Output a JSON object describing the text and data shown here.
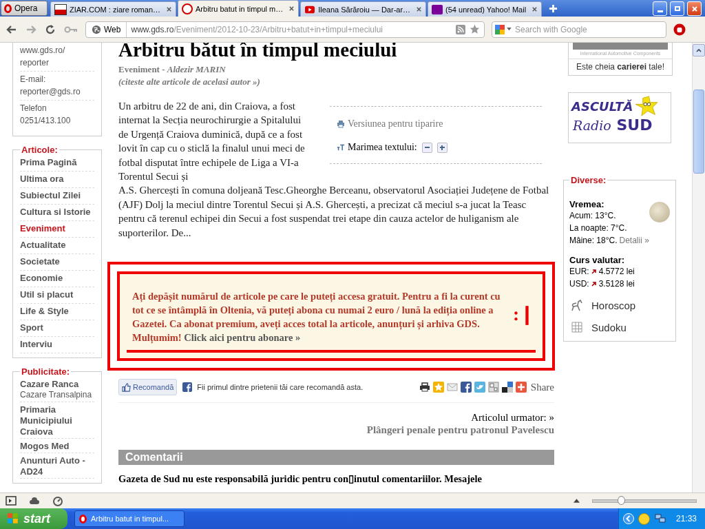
{
  "browser": {
    "menu_button": "Opera",
    "tabs": [
      {
        "label": "ZIAR.COM : ziare roman…",
        "selected": false,
        "kind": "ziar"
      },
      {
        "label": "Arbitru batut in timpul m…",
        "selected": true,
        "kind": "gds"
      },
      {
        "label": "Ileana Sărăroiu — Dar-ar…",
        "selected": false,
        "kind": "video"
      },
      {
        "label": "(54 unread) Yahoo! Mail",
        "selected": false,
        "kind": "yahoo"
      }
    ],
    "address": {
      "badge": "Web",
      "host": "www.gds.ro",
      "path": "/Eveniment/2012-10-23/Arbitru+batut+in+timpul+meciului"
    },
    "search": {
      "placeholder": "Search with Google"
    }
  },
  "sidebar": {
    "contact": [
      "www.gds.ro/ reporter",
      "E-mail: reporter@gds.ro",
      "Telefon 0251/413.100"
    ],
    "articles": {
      "title": "Articole:",
      "items": [
        {
          "label": "Prima Pagină",
          "selected": false
        },
        {
          "label": "Ultima ora",
          "selected": false
        },
        {
          "label": "Subiectul Zilei",
          "selected": false
        },
        {
          "label": "Cultura si Istorie",
          "selected": false
        },
        {
          "label": "Eveniment",
          "selected": true
        },
        {
          "label": "Actualitate",
          "selected": false
        },
        {
          "label": "Societate",
          "selected": false
        },
        {
          "label": "Economie",
          "selected": false
        },
        {
          "label": "Util si placut",
          "selected": false
        },
        {
          "label": "Life & Style",
          "selected": false
        },
        {
          "label": "Sport",
          "selected": false
        },
        {
          "label": "Interviu",
          "selected": false
        }
      ]
    },
    "ads": {
      "title": "Publicitate:",
      "items": [
        {
          "label": "Cazare Ranca",
          "sub": "Cazare Transalpina"
        },
        {
          "label": "Primaria Municipiului Craiova"
        },
        {
          "label": "Mogos Med"
        },
        {
          "label": "Anunturi Auto - AD24"
        }
      ]
    }
  },
  "article": {
    "title": "Arbitru bătut în timpul meciului",
    "byline": "Eveniment - *Aldezir MARIN*",
    "author_link": "(citeste alte articole de acelasi autor »)",
    "print_link": "Versiunea pentru tiparire",
    "text_size": "Marimea textului:",
    "body_lead": "Un arbitru de 22 de ani, din Craiova, a fost internat la Secția neurochirurgie a Spitalului de Urgență Craiova duminică, după ce a fost lovit în cap cu o sticlă la finalul unui meci de fotbal disputat între echipele de Liga a VI-a Torentul Secui și",
    "body_rest": "A.S. Ghercești în comuna doljeană Tesc.Gheorghe Berceanu, observatorul Asociației Județene de Fotbal (AJF) Dolj la meciul dintre Torentul Secui și A.S. Ghercești, a precizat că meciul s-a jucat la Teasc pentru că terenul echipei din Secui a fost suspendat trei etape din cauza actelor de huliganism ale suporterilor. De...",
    "notice": {
      "text": "Ați depășit numărul de articole pe care le puteți accesa gratuit. Pentru a fi la curent cu tot ce se întâmplă în Oltenia, vă puteți abona cu numai 2 euro / lună la ediția online a Gazetei. Ca abonat premium, aveți acces total la articole, anunțuri și arhiva GDS. Mulțumim!",
      "link": "Click aici pentru abonare »"
    },
    "recommend": "Recomandă",
    "recommend_text": "Fii primul dintre prietenii tăi care recomandă asta.",
    "share": "Share",
    "next_label": "Articolul urmator: »",
    "next_title": "Plângeri penale pentru patronul Pavelescu",
    "comments_heading": "Comentarii",
    "disclaimer": "Gazeta de Sud nu este responsabilă juridic pentru con▯inutul comentariilor. Mesajele"
  },
  "right": {
    "ad_caption": "International Automotive Components",
    "ad_tagline": "Este cheia **carierei** tale!",
    "radio_top": "ASCULTĂ",
    "radio_bottom_1": "Radio",
    "radio_bottom_2": "SUD",
    "diverse": {
      "title": "Diverse:",
      "weather_title": "Vremea:",
      "weather": [
        "Acum: 13°C.",
        "La noapte: 7°C.",
        "Mâine: 18°C."
      ],
      "details": "Detalii »",
      "currency_title": "Curs valutar:",
      "rates": [
        "EUR:",
        "USD:"
      ],
      "rate_values": [
        "4.5772 lei",
        "3.5128 lei"
      ],
      "horoscope": "Horoscop",
      "sudoku": "Sudoku"
    }
  },
  "status": {
    "zoom": {
      "level": 0.27
    }
  },
  "taskbar": {
    "start": "start",
    "task": "Arbitru batut in timpul...",
    "clock": "21:33"
  }
}
